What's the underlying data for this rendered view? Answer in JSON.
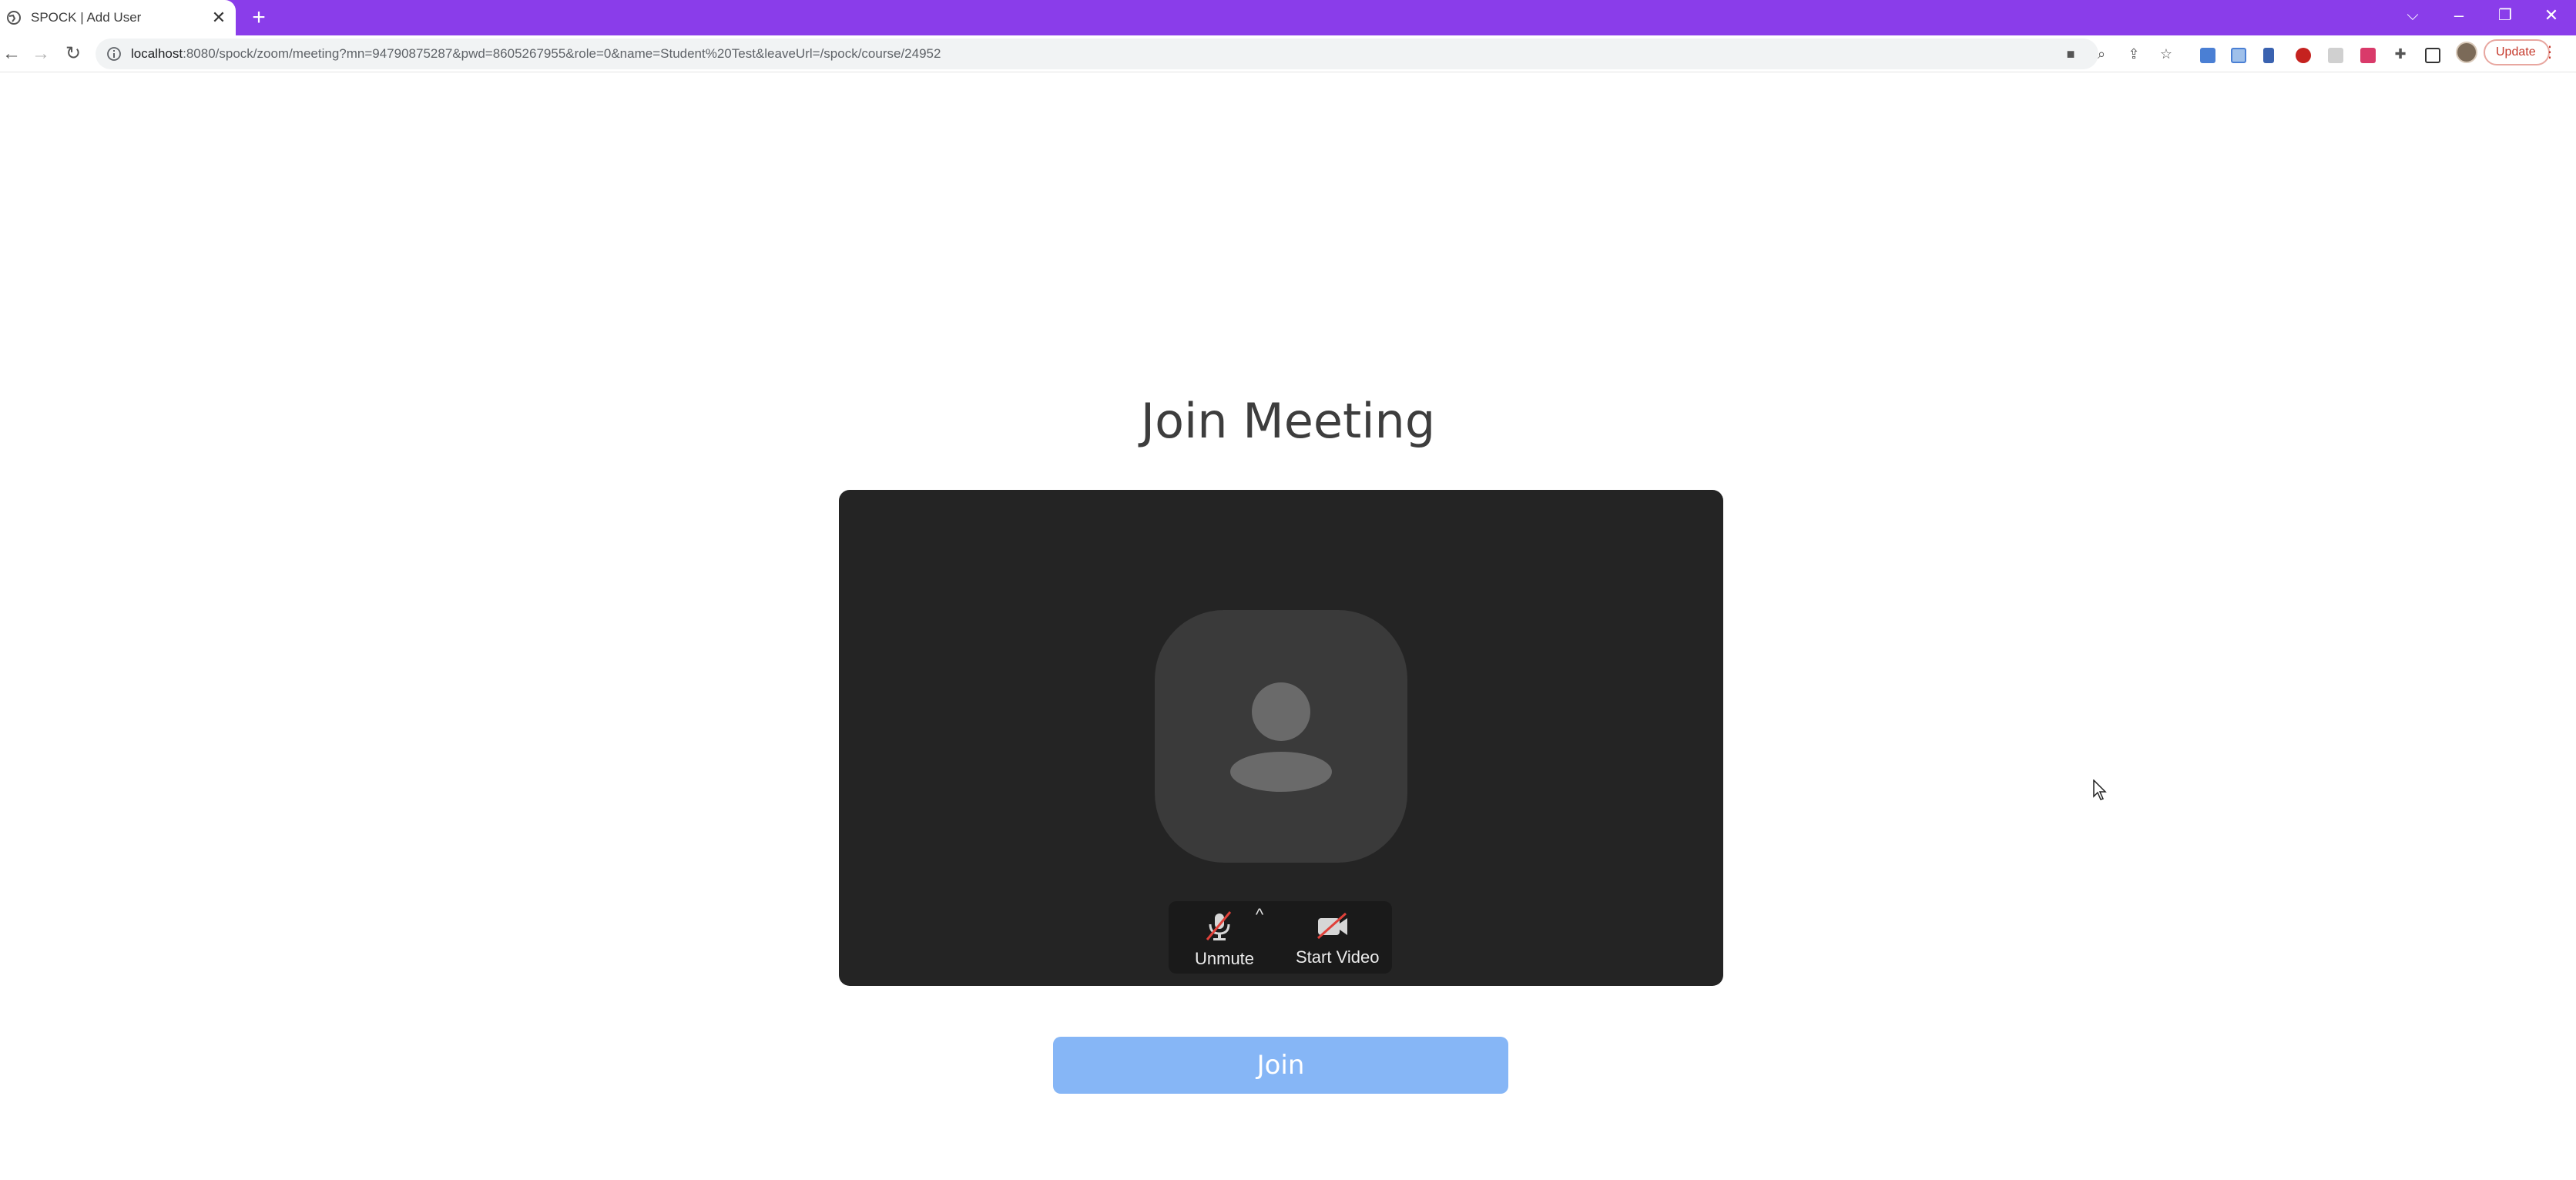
{
  "browser": {
    "tab": {
      "title": "SPOCK | Add User",
      "close_glyph": "✕",
      "favicon": "globe-icon"
    },
    "new_tab_glyph": "+",
    "window_controls": {
      "dropdown": "⌵",
      "minimize": "–",
      "restore": "❐",
      "close": "✕"
    },
    "address": {
      "host": "localhost",
      "rest": ":8080/spock/zoom/meeting?mn=94790875287&pwd=8605267955&role=0&name=Student%20Test&leaveUrl=/spock/course/24952"
    },
    "update_label": "Update",
    "accent_color": "#8a3dea"
  },
  "page": {
    "title": "Join Meeting",
    "preview": {
      "unmute_label": "Unmute",
      "start_video_label": "Start Video",
      "caret": "^"
    },
    "join_label": "Join",
    "join_color": "#86b6f6"
  }
}
